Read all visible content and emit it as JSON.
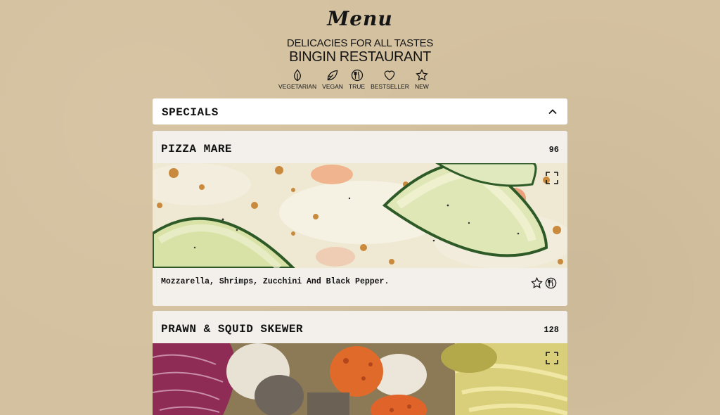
{
  "header": {
    "title": "Menu",
    "tagline": "DELICACIES FOR ALL TASTES",
    "restaurant": "BINGIN RESTAURANT"
  },
  "legend": [
    {
      "icon": "leaf-icon",
      "label": "VEGETARIAN"
    },
    {
      "icon": "vegan-leaf-icon",
      "label": "VEGAN"
    },
    {
      "icon": "cutlery-icon",
      "label": "TRUE"
    },
    {
      "icon": "heart-icon",
      "label": "BESTSELLER"
    },
    {
      "icon": "star-icon",
      "label": "NEW"
    }
  ],
  "section": {
    "title": "SPECIALS",
    "expanded": true
  },
  "items": [
    {
      "name": "PIZZA MARE",
      "price": "96",
      "description": "Mozzarella, Shrimps, Zucchini And Black Pepper.",
      "badges": [
        "star-icon",
        "cutlery-icon"
      ]
    },
    {
      "name": "PRAWN & SQUID SKEWER",
      "price": "128"
    }
  ],
  "colors": {
    "background": "#d4c19f",
    "card": "#f3f0ec",
    "text": "#151515"
  }
}
